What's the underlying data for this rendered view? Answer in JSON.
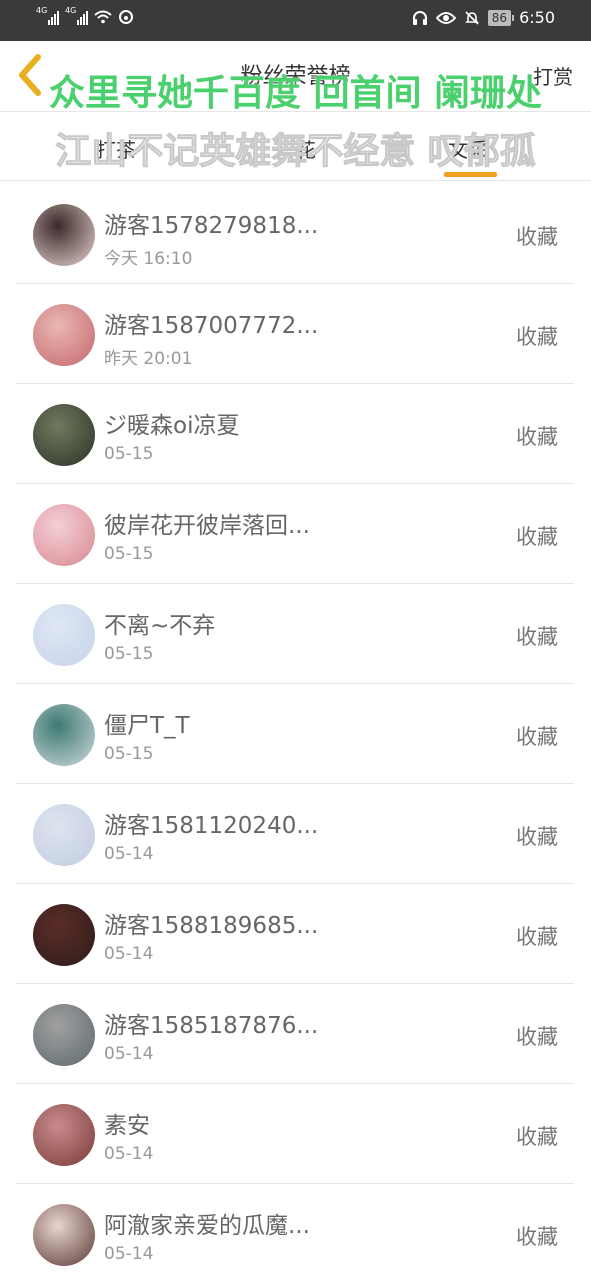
{
  "status_bar": {
    "network_1": "4G",
    "network_2": "4G",
    "battery": "86",
    "time": "6:50"
  },
  "header": {
    "title": "粉丝荣誉榜",
    "reward": "打赏"
  },
  "overlay": {
    "line1": "众里寻她千百度 回首间 阑珊处",
    "line2": "江山不记英雄舞不经意 叹郁孤"
  },
  "tabs": [
    {
      "label": "打茶"
    },
    {
      "label": "花"
    },
    {
      "label": "文采"
    }
  ],
  "list": [
    {
      "name": "游客1578279818...",
      "time": "今天 16:10",
      "action": "收藏",
      "avatar_colors": [
        "#3b2a2a",
        "#e6d3cf"
      ]
    },
    {
      "name": "游客1587007772...",
      "time": "昨天 20:01",
      "action": "收藏",
      "avatar_colors": [
        "#e9b7b3",
        "#c4686c"
      ]
    },
    {
      "name": "ジ暖森oi凉夏",
      "time": "05-15",
      "action": "收藏",
      "avatar_colors": [
        "#6f7a5e",
        "#2d3326"
      ]
    },
    {
      "name": "彼岸花开彼岸落回...",
      "time": "05-15",
      "action": "收藏",
      "avatar_colors": [
        "#f4cfd6",
        "#d8888f"
      ]
    },
    {
      "name": "不离~不弃",
      "time": "05-15",
      "action": "收藏",
      "avatar_colors": [
        "#dfe7f4",
        "#c6d3ea"
      ]
    },
    {
      "name": "僵尸T_T",
      "time": "05-15",
      "action": "收藏",
      "avatar_colors": [
        "#3d7a72",
        "#cfd9dc"
      ]
    },
    {
      "name": "游客1581120240...",
      "time": "05-14",
      "action": "收藏",
      "avatar_colors": [
        "#dde4f0",
        "#c2cde0"
      ]
    },
    {
      "name": "游客1588189685...",
      "time": "05-14",
      "action": "收藏",
      "avatar_colors": [
        "#5a2c28",
        "#2e1d1b"
      ]
    },
    {
      "name": "游客1585187876...",
      "time": "05-14",
      "action": "收藏",
      "avatar_colors": [
        "#a0a0a0",
        "#5e6a6e"
      ]
    },
    {
      "name": "素安",
      "time": "05-14",
      "action": "收藏",
      "avatar_colors": [
        "#c98b8c",
        "#7a3a3a"
      ]
    },
    {
      "name": "阿澈家亲爱的瓜魔...",
      "time": "05-14",
      "action": "收藏",
      "avatar_colors": [
        "#e8d4cf",
        "#5a3a34"
      ]
    }
  ],
  "colors": {
    "status_bar_bg": "#3a3a3a",
    "accent": "#f0a020",
    "back_arrow": "#e8b020",
    "overlay_green": "#4ad06c"
  }
}
